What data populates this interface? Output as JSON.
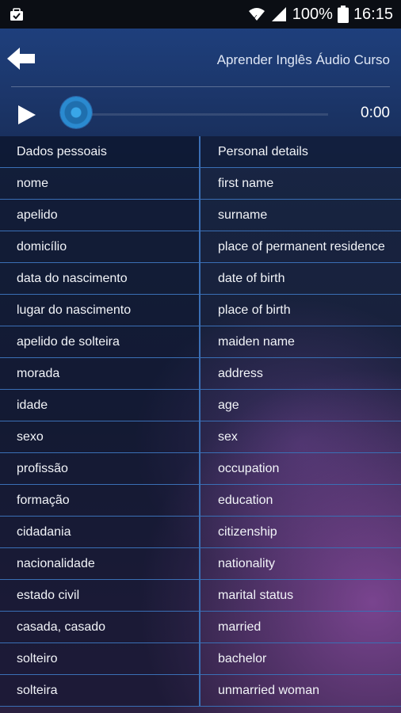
{
  "status_bar": {
    "battery_percent": "100%",
    "time": "16:15",
    "icons": [
      "notification-icon",
      "wifi-icon",
      "signal-icon",
      "battery-icon"
    ]
  },
  "header": {
    "title": "Aprender Inglês Áudio Curso",
    "back_icon": "arrow-left-icon",
    "play_icon": "play-icon",
    "time": "0:00",
    "progress": 0
  },
  "table": {
    "heading": {
      "left": "Dados pessoais",
      "right": "Personal details"
    },
    "rows": [
      {
        "left": "nome",
        "right": "first name"
      },
      {
        "left": "apelido",
        "right": "surname"
      },
      {
        "left": "domicílio",
        "right": "place of permanent residence"
      },
      {
        "left": "data do nascimento",
        "right": "date of birth"
      },
      {
        "left": "lugar do nascimento",
        "right": "place of birth"
      },
      {
        "left": "apelido de solteira",
        "right": "maiden name"
      },
      {
        "left": "morada",
        "right": "address"
      },
      {
        "left": "idade",
        "right": "age"
      },
      {
        "left": "sexo",
        "right": "sex"
      },
      {
        "left": "profissão",
        "right": "occupation"
      },
      {
        "left": "formação",
        "right": "education"
      },
      {
        "left": "cidadania",
        "right": "citizenship"
      },
      {
        "left": "nacionalidade",
        "right": "nationality"
      },
      {
        "left": "estado civil",
        "right": "marital status"
      },
      {
        "left": "casada, casado",
        "right": "married"
      },
      {
        "left": "solteiro",
        "right": "bachelor"
      },
      {
        "left": "solteira",
        "right": "unmarried woman"
      }
    ]
  },
  "colors": {
    "status_bar": "#0b0e14",
    "header": "#1e3f7c",
    "grid_line": "#3a6fb5",
    "seek_knob": "#39a6e8"
  }
}
